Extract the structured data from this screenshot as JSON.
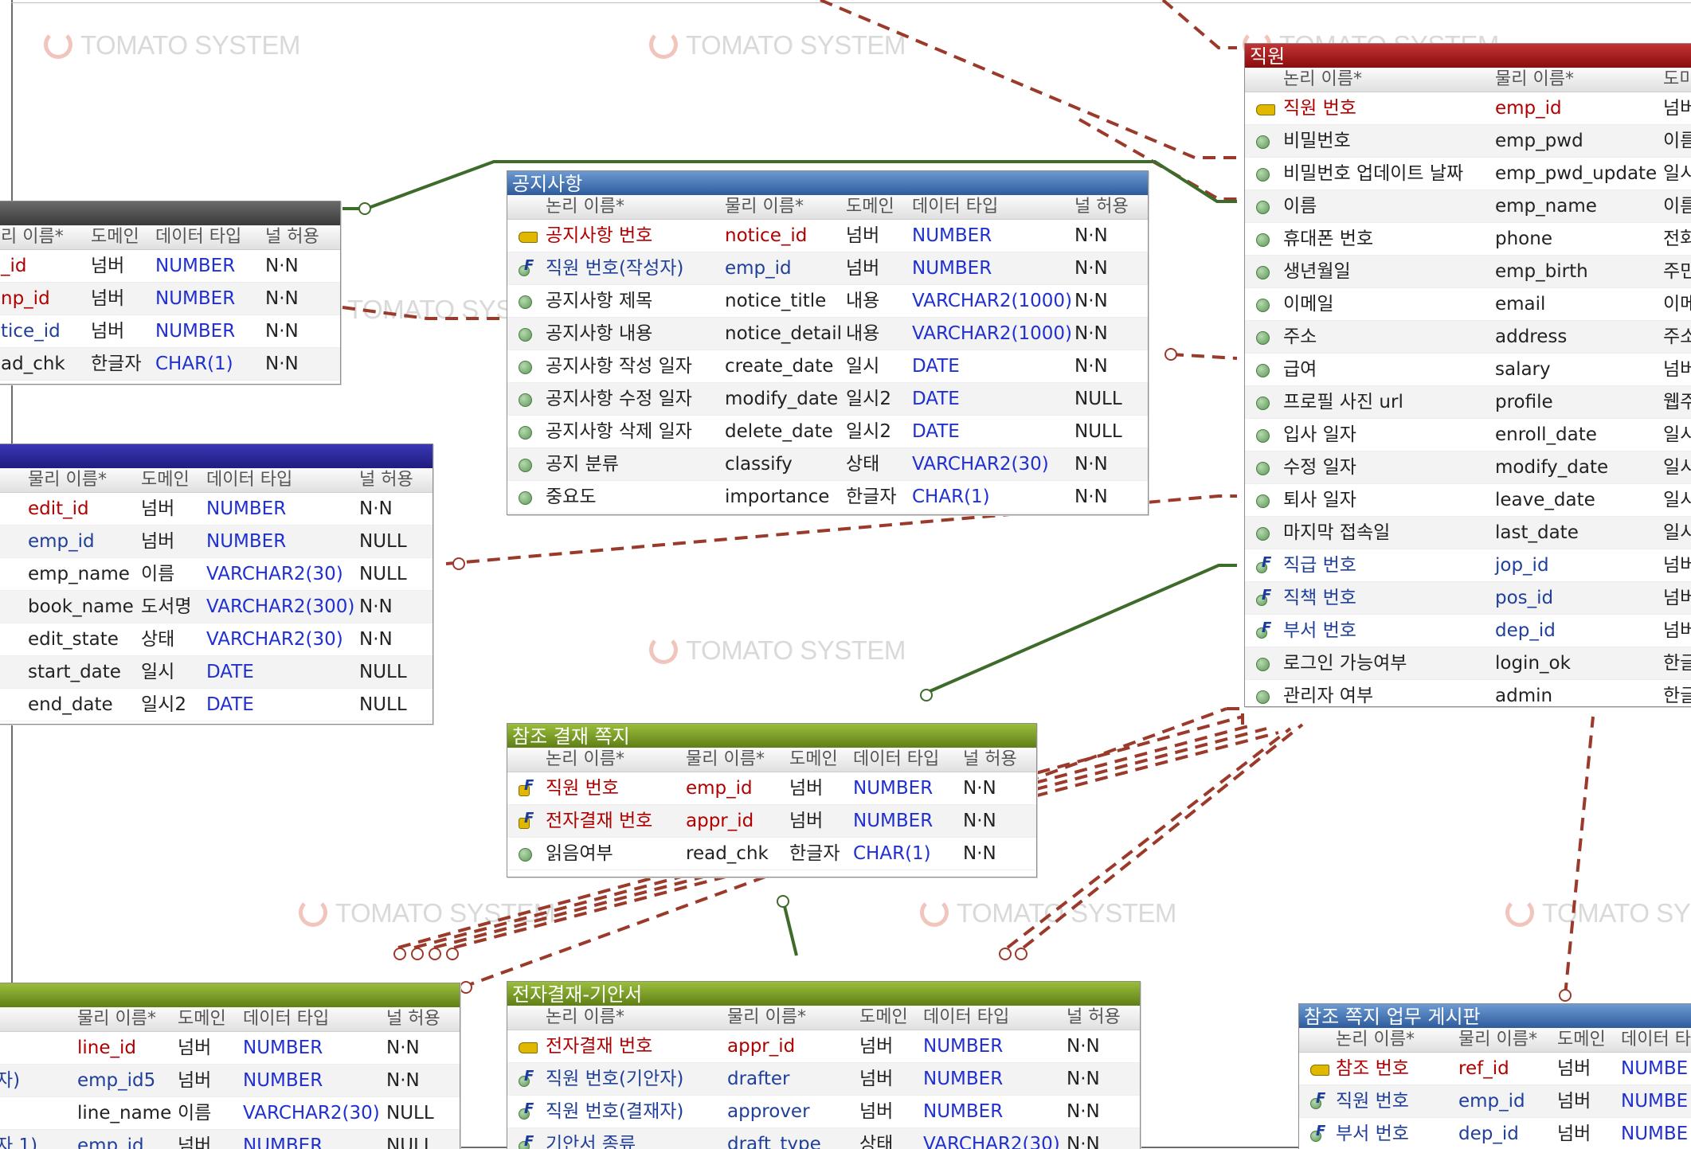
{
  "watermark": "TOMATO SYSTEM",
  "headers": {
    "logical": "논리 이름*",
    "physical": "물리 이름*",
    "domain": "도메인",
    "datatype": "데이터 타입",
    "nullable": "널 허용",
    "partial_logical": "리 이름*",
    "partial_domain": "도미"
  },
  "colors": {
    "relation_red": "#9b3a2a",
    "relation_green": "#3d6b2a",
    "pk_text": "#b00000",
    "fk_text": "#1f3f9a",
    "type_text": "#2030d0"
  },
  "tables": {
    "left_top": {
      "title": "",
      "rows": [
        {
          "physical": "_id",
          "domain": "넘버",
          "type": "NUMBER",
          "null": "N·N"
        },
        {
          "physical": "np_id",
          "domain": "넘버",
          "type": "NUMBER",
          "null": "N·N"
        },
        {
          "physical": "tice_id",
          "domain": "넘버",
          "type": "NUMBER",
          "null": "N·N"
        },
        {
          "physical": "ad_chk",
          "domain": "한글자",
          "type": "CHAR(1)",
          "null": "N·N"
        }
      ]
    },
    "left_mid": {
      "title": "",
      "rows": [
        {
          "physical": "edit_id",
          "domain": "넘버",
          "type": "NUMBER",
          "null": "N·N"
        },
        {
          "physical": "emp_id",
          "domain": "넘버",
          "type": "NUMBER",
          "null": "NULL"
        },
        {
          "physical": "emp_name",
          "domain": "이름",
          "type": "VARCHAR2(30)",
          "null": "NULL"
        },
        {
          "physical": "book_name",
          "domain": "도서명",
          "type": "VARCHAR2(300)",
          "null": "N·N"
        },
        {
          "physical": "edit_state",
          "domain": "상태",
          "type": "VARCHAR2(30)",
          "null": "N·N"
        },
        {
          "physical": "start_date",
          "domain": "일시",
          "type": "DATE",
          "null": "NULL"
        },
        {
          "physical": "end_date",
          "domain": "일시2",
          "type": "DATE",
          "null": "NULL"
        }
      ]
    },
    "notice": {
      "title": "공지사항",
      "rows": [
        {
          "logical": "공지사항 번호",
          "physical": "notice_id",
          "domain": "넘버",
          "type": "NUMBER",
          "null": "N·N"
        },
        {
          "logical": "직원 번호(작성자)",
          "physical": "emp_id",
          "domain": "넘버",
          "type": "NUMBER",
          "null": "N·N"
        },
        {
          "logical": "공지사항 제목",
          "physical": "notice_title",
          "domain": "내용",
          "type": "VARCHAR2(1000)",
          "null": "N·N"
        },
        {
          "logical": "공지사항 내용",
          "physical": "notice_detail",
          "domain": "내용",
          "type": "VARCHAR2(1000)",
          "null": "N·N"
        },
        {
          "logical": "공지사항 작성 일자",
          "physical": "create_date",
          "domain": "일시",
          "type": "DATE",
          "null": "N·N"
        },
        {
          "logical": "공지사항 수정 일자",
          "physical": "modify_date",
          "domain": "일시2",
          "type": "DATE",
          "null": "NULL"
        },
        {
          "logical": "공지사항 삭제 일자",
          "physical": "delete_date",
          "domain": "일시2",
          "type": "DATE",
          "null": "NULL"
        },
        {
          "logical": "공지 분류",
          "physical": "classify",
          "domain": "상태",
          "type": "VARCHAR2(30)",
          "null": "N·N"
        },
        {
          "logical": "중요도",
          "physical": "importance",
          "domain": "한글자",
          "type": "CHAR(1)",
          "null": "N·N"
        }
      ]
    },
    "employee": {
      "title": "직원",
      "rows": [
        {
          "logical": "직원 번호",
          "physical": "emp_id",
          "domain": "넘버"
        },
        {
          "logical": "비밀번호",
          "physical": "emp_pwd",
          "domain": "이름"
        },
        {
          "logical": "비밀번호 업데이트 날짜",
          "physical": "emp_pwd_update",
          "domain": "일시"
        },
        {
          "logical": "이름",
          "physical": "emp_name",
          "domain": "이름"
        },
        {
          "logical": "휴대폰 번호",
          "physical": "phone",
          "domain": "전화"
        },
        {
          "logical": "생년월일",
          "physical": "emp_birth",
          "domain": "주민"
        },
        {
          "logical": "이메일",
          "physical": "email",
          "domain": "이메"
        },
        {
          "logical": "주소",
          "physical": "address",
          "domain": "주소"
        },
        {
          "logical": "급여",
          "physical": "salary",
          "domain": "넘버"
        },
        {
          "logical": "프로필 사진 url",
          "physical": "profile",
          "domain": "웹주"
        },
        {
          "logical": "입사 일자",
          "physical": "enroll_date",
          "domain": "일시"
        },
        {
          "logical": "수정 일자",
          "physical": "modify_date",
          "domain": "일시"
        },
        {
          "logical": "퇴사 일자",
          "physical": "leave_date",
          "domain": "일시"
        },
        {
          "logical": "마지막 접속일",
          "physical": "last_date",
          "domain": "일시"
        },
        {
          "logical": "직급 번호",
          "physical": "jop_id",
          "domain": "넘버"
        },
        {
          "logical": "직책 번호",
          "physical": "pos_id",
          "domain": "넘버"
        },
        {
          "logical": "부서 번호",
          "physical": "dep_id",
          "domain": "넘버"
        },
        {
          "logical": "로그인 가능여부",
          "physical": "login_ok",
          "domain": "한글"
        },
        {
          "logical": "관리자 여부",
          "physical": "admin",
          "domain": "한글"
        }
      ]
    },
    "ref_approval_note": {
      "title": "참조 결재 쪽지",
      "rows": [
        {
          "logical": "직원 번호",
          "physical": "emp_id",
          "domain": "넘버",
          "type": "NUMBER",
          "null": "N·N"
        },
        {
          "logical": "전자결재 번호",
          "physical": "appr_id",
          "domain": "넘버",
          "type": "NUMBER",
          "null": "N·N"
        },
        {
          "logical": "읽음여부",
          "physical": "read_chk",
          "domain": "한글자",
          "type": "CHAR(1)",
          "null": "N·N"
        }
      ]
    },
    "left_bottom": {
      "title": "",
      "rows": [
        {
          "logical": "",
          "physical": "line_id",
          "domain": "넘버",
          "type": "NUMBER",
          "null": "N·N"
        },
        {
          "logical": "자)",
          "physical": "emp_id5",
          "domain": "넘버",
          "type": "NUMBER",
          "null": "N·N"
        },
        {
          "logical": "",
          "physical": "line_name",
          "domain": "이름",
          "type": "VARCHAR2(30)",
          "null": "NULL"
        },
        {
          "logical": "자 1)",
          "physical": "emp_id",
          "domain": "넘버",
          "type": "NUMBER",
          "null": "NULL"
        }
      ]
    },
    "draft": {
      "title": "전자결재-기안서",
      "rows": [
        {
          "logical": "전자결재 번호",
          "physical": "appr_id",
          "domain": "넘버",
          "type": "NUMBER",
          "null": "N·N"
        },
        {
          "logical": "직원 번호(기안자)",
          "physical": "drafter",
          "domain": "넘버",
          "type": "NUMBER",
          "null": "N·N"
        },
        {
          "logical": "직원 번호(결재자)",
          "physical": "approver",
          "domain": "넘버",
          "type": "NUMBER",
          "null": "N·N"
        },
        {
          "logical": "기안서 종류",
          "physical": "draft_type",
          "domain": "상태",
          "type": "VARCHAR2(30)",
          "null": "N·N"
        }
      ]
    },
    "ref_board": {
      "title": "참조 쪽지 업무 게시판",
      "rows": [
        {
          "logical": "참조 번호",
          "physical": "ref_id",
          "domain": "넘버",
          "type": "NUMBE"
        },
        {
          "logical": "직원 번호",
          "physical": "emp_id",
          "domain": "넘버",
          "type": "NUMBE"
        },
        {
          "logical": "부서 번호",
          "physical": "dep_id",
          "domain": "넘버",
          "type": "NUMBE"
        }
      ]
    }
  }
}
